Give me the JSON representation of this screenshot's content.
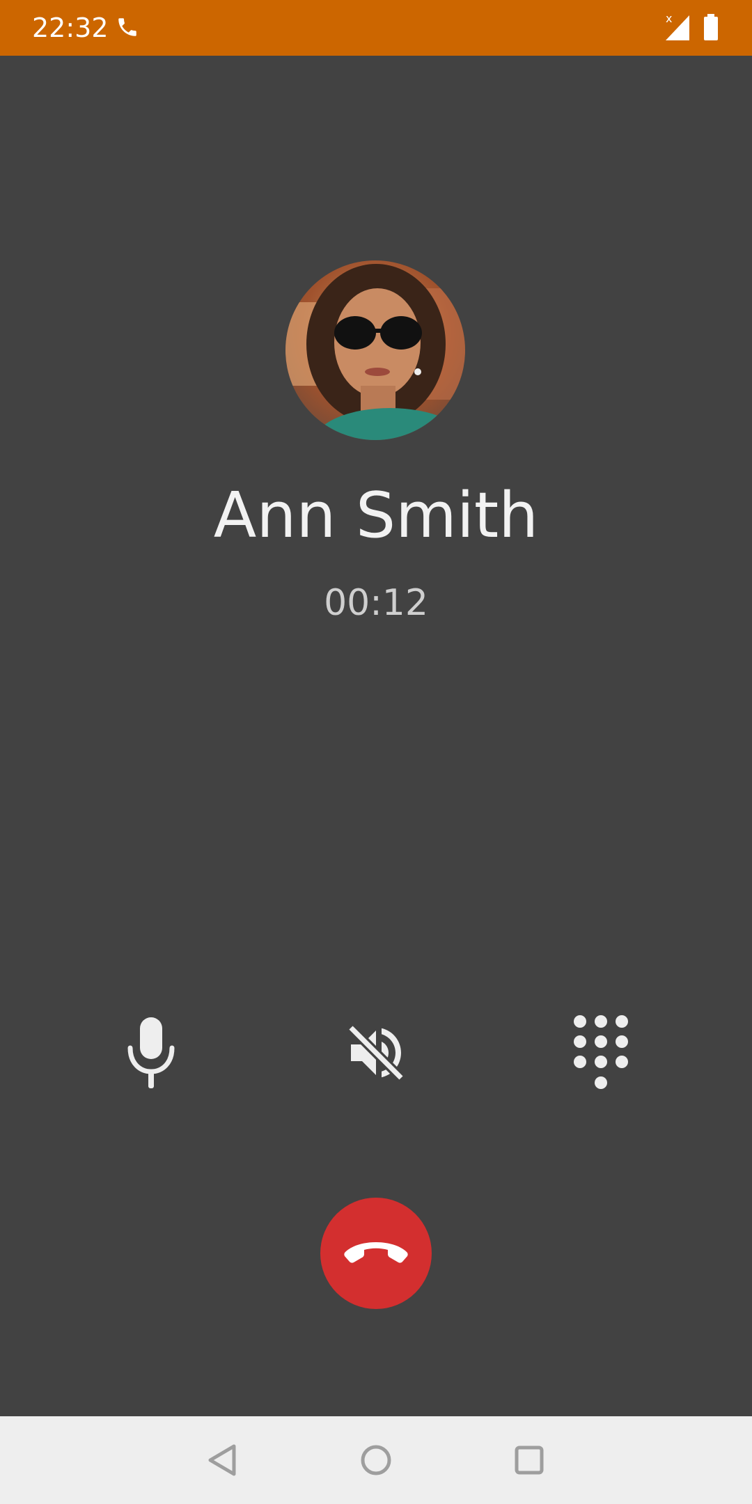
{
  "status_bar": {
    "time": "22:32",
    "background_color": "#cc6600",
    "icons": [
      "call-icon",
      "signal-icon",
      "battery-icon"
    ]
  },
  "call": {
    "contact_name": "Ann Smith",
    "duration": "00:12",
    "avatar_icon": "contact-photo"
  },
  "controls": {
    "mute_icon": "microphone-icon",
    "speaker_icon": "speaker-off-icon",
    "dialpad_icon": "dialpad-icon",
    "end_call_icon": "end-call-icon",
    "end_call_color": "#d32f2f"
  },
  "nav_bar": {
    "icons": [
      "back-icon",
      "home-icon",
      "recents-icon"
    ]
  }
}
